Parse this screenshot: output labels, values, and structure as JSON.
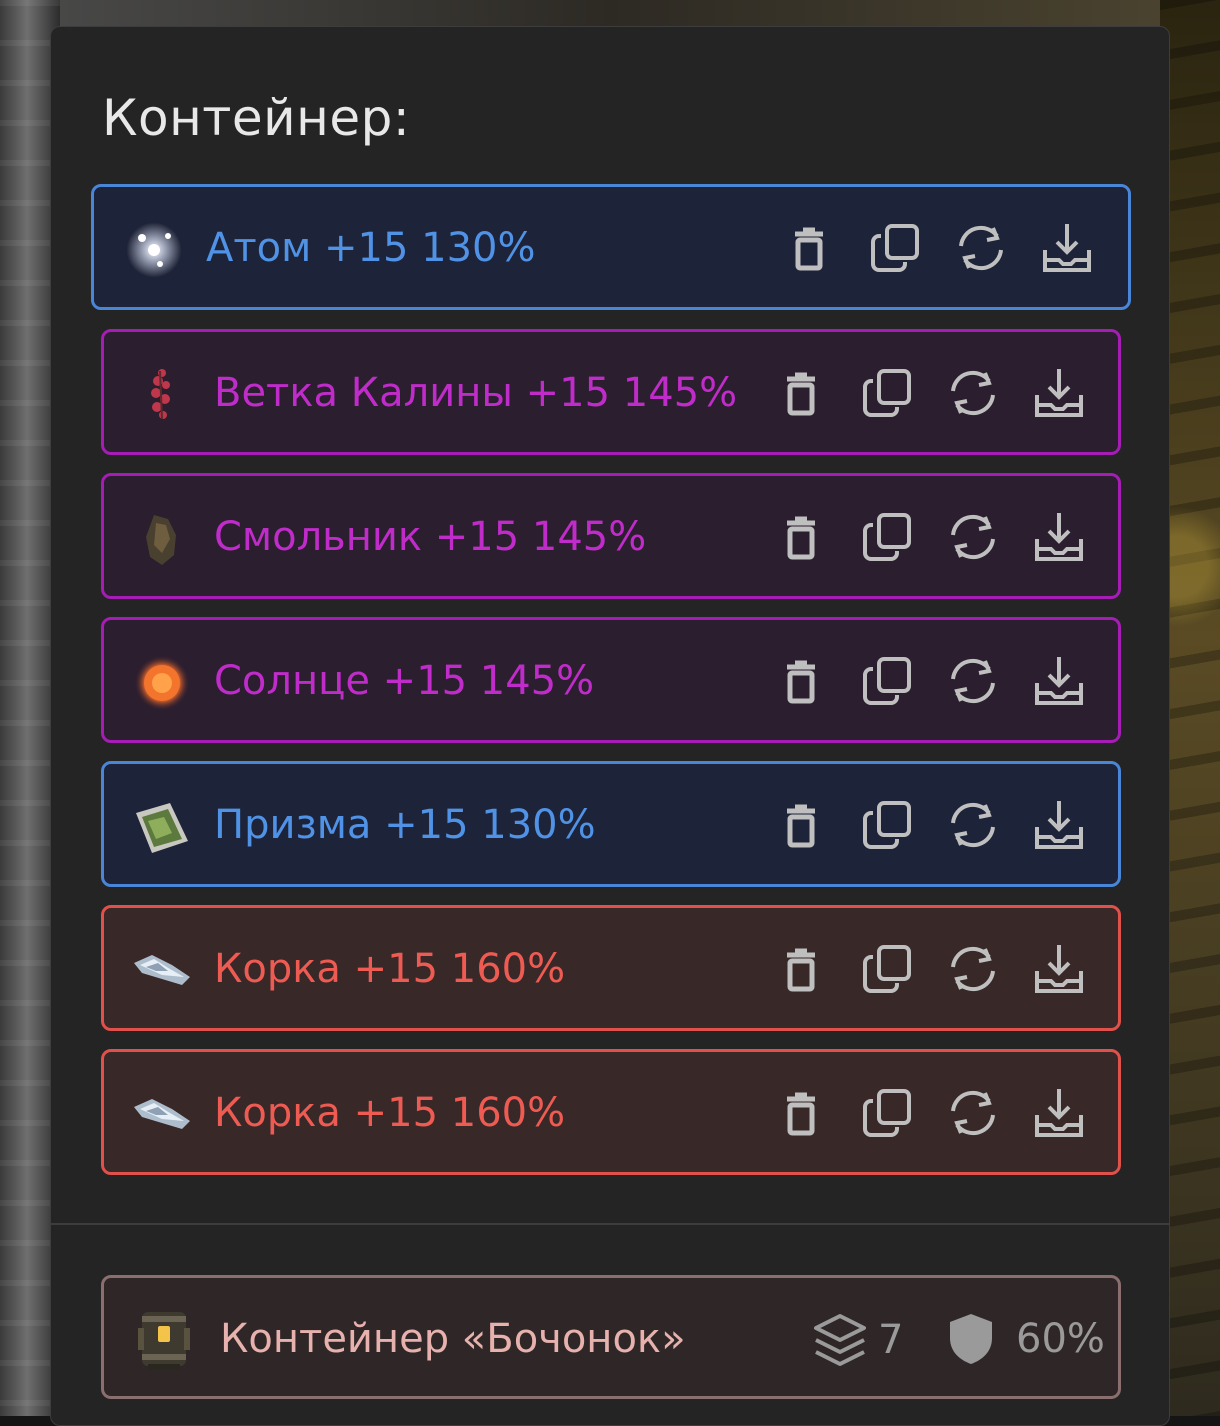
{
  "title": "Контейнер:",
  "items": [
    {
      "name": "Атом +15 130%",
      "rarity": "blue",
      "icon": "atom-artifact-icon"
    },
    {
      "name": "Ветка Калины +15 145%",
      "rarity": "purple",
      "icon": "viburnum-branch-artifact-icon"
    },
    {
      "name": "Смольник +15 145%",
      "rarity": "purple",
      "icon": "resin-artifact-icon"
    },
    {
      "name": "Солнце +15 145%",
      "rarity": "purple",
      "icon": "sun-artifact-icon"
    },
    {
      "name": "Призма +15 130%",
      "rarity": "blue",
      "icon": "prism-artifact-icon"
    },
    {
      "name": "Корка +15 160%",
      "rarity": "red",
      "icon": "crust-artifact-icon"
    },
    {
      "name": "Корка +15 160%",
      "rarity": "red",
      "icon": "crust-artifact-icon"
    }
  ],
  "actions": [
    "trash-icon",
    "copy-icon",
    "refresh-icon",
    "download-icon"
  ],
  "container": {
    "name": "Контейнер «Бочонок»",
    "slots": "7",
    "protection": "60%",
    "icon": "barrel-container-icon"
  },
  "colors": {
    "blue": "#4a86d8",
    "purple": "#a51db5",
    "red": "#e1514b",
    "panel": "#242424",
    "icon_gray": "#9a9a9a"
  }
}
